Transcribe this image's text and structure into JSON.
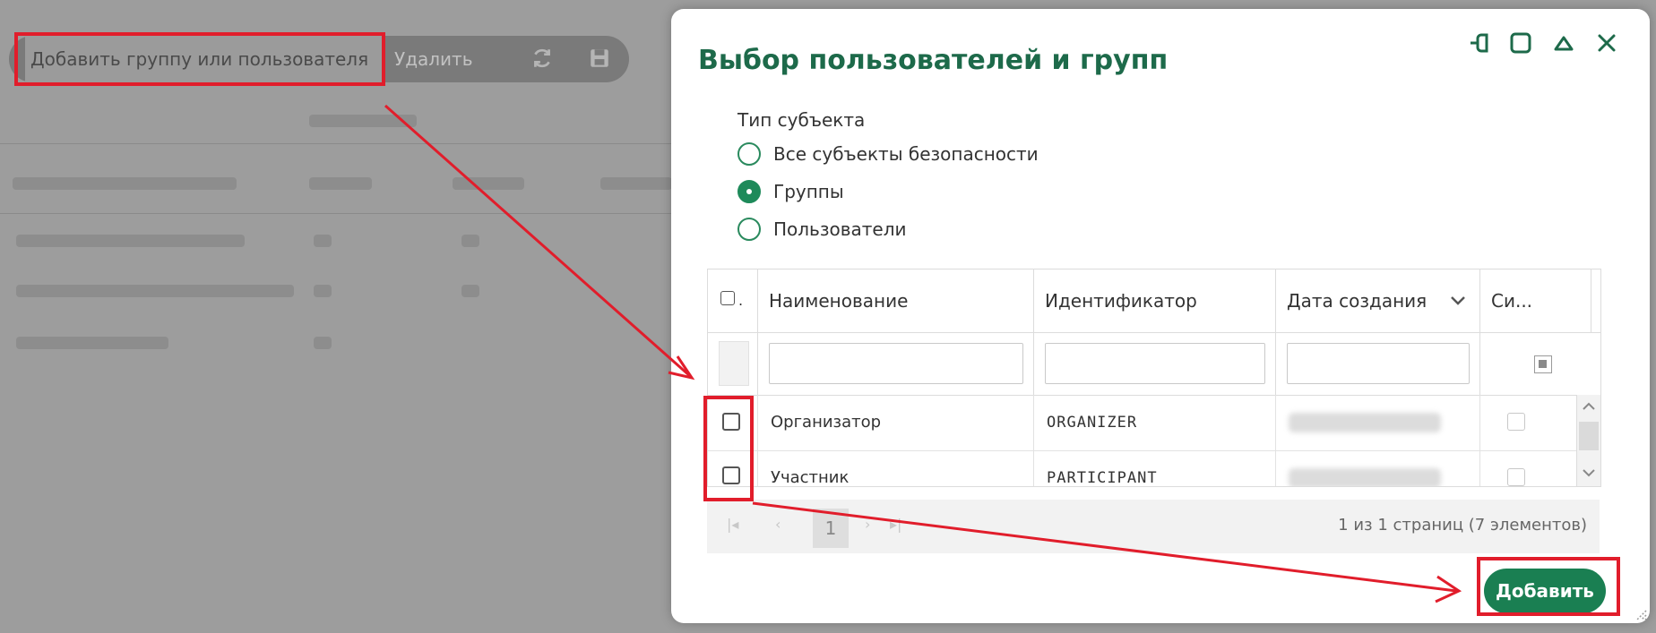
{
  "background": {
    "toolbar": {
      "add_label": "Добавить группу или пользователя",
      "delete_label": "Удалить"
    }
  },
  "dialog": {
    "title": "Выбор пользователей и групп",
    "subject_type": {
      "label": "Тип субъекта",
      "options": [
        "Все субъекты безопасности",
        "Группы",
        "Пользователи"
      ],
      "selected": "Группы"
    },
    "table": {
      "columns": [
        "Наименование",
        "Идентификатор",
        "Дата создания",
        "Си..."
      ],
      "rows": [
        {
          "name": "Организатор",
          "id": "ORGANIZER"
        },
        {
          "name": "Участник",
          "id": "PARTICIPANT"
        }
      ]
    },
    "pager": {
      "page": "1",
      "info": "1 из 1 страниц (7 элементов)"
    },
    "add_button": "Добавить"
  },
  "colors": {
    "accent": "#1a7f52",
    "title": "#1d6a4a",
    "highlight": "#e11d2b"
  },
  "icons": [
    "refresh-icon",
    "save-icon",
    "pin-icon",
    "maximize-icon",
    "collapse-icon",
    "close-icon",
    "sort-chevron-icon"
  ]
}
